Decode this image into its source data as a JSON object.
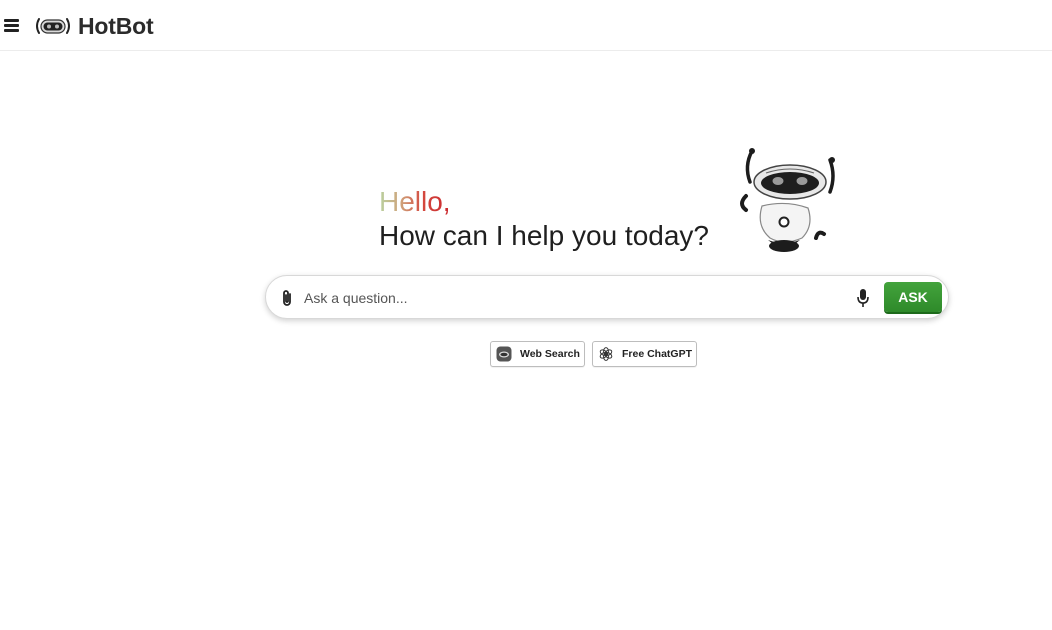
{
  "header": {
    "menu_icon": "hamburger-menu-icon",
    "logo_icon": "robot-face-icon",
    "brand_name": "HotBot"
  },
  "hero": {
    "greeting": "Hello,",
    "subtitle": "How can I help you today?",
    "mascot_icon": "robot-mascot-waving"
  },
  "search": {
    "placeholder": "Ask a question...",
    "value": "",
    "attach_icon": "paperclip-icon",
    "mic_icon": "microphone-icon",
    "ask_label": "ASK"
  },
  "modes": [
    {
      "label": "Web Search",
      "icon": "robot-chip-icon"
    },
    {
      "label": "Free ChatGPT",
      "icon": "openai-icon"
    }
  ],
  "colors": {
    "ask_button": "#3a9a34",
    "hello_start": "#b9d2a0",
    "hello_end": "#c8232b",
    "text": "#1f1f1f"
  }
}
